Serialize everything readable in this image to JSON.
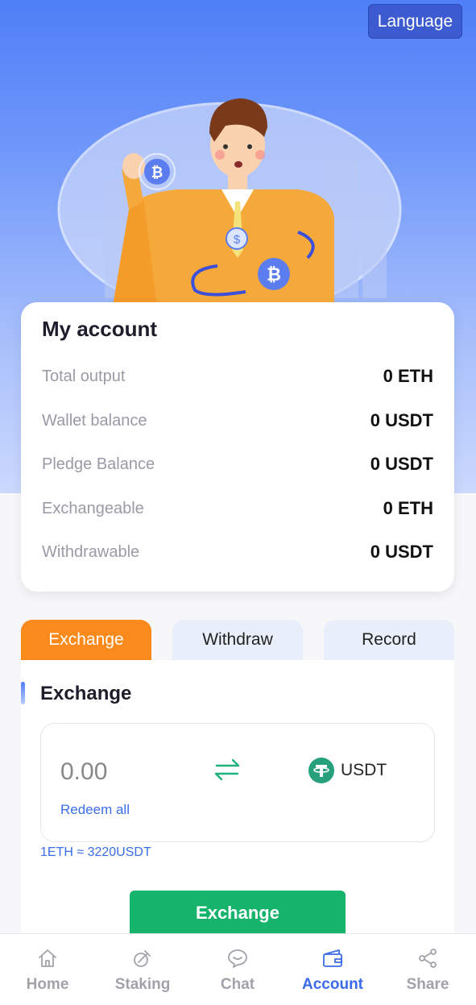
{
  "header": {
    "language_label": "Language"
  },
  "account": {
    "title": "My account",
    "rows": [
      {
        "label": "Total output",
        "value": "0 ETH"
      },
      {
        "label": "Wallet balance",
        "value": "0 USDT"
      },
      {
        "label": "Pledge Balance",
        "value": "0 USDT"
      },
      {
        "label": "Exchangeable",
        "value": "0 ETH"
      },
      {
        "label": "Withdrawable",
        "value": "0 USDT"
      }
    ]
  },
  "tabs": [
    {
      "label": "Exchange",
      "active": true
    },
    {
      "label": "Withdraw",
      "active": false
    },
    {
      "label": "Record",
      "active": false
    }
  ],
  "exchange": {
    "title": "Exchange",
    "amount_placeholder": "0.00",
    "amount_value": "",
    "redeem_all": "Redeem all",
    "to_currency": "USDT",
    "rate": "1ETH ≈ 3220USDT",
    "button_label": "Exchange"
  },
  "nav": [
    {
      "label": "Home",
      "icon": "home-icon",
      "active": false
    },
    {
      "label": "Staking",
      "icon": "staking-icon",
      "active": false
    },
    {
      "label": "Chat",
      "icon": "chat-icon",
      "active": false
    },
    {
      "label": "Account",
      "icon": "wallet-icon",
      "active": true
    },
    {
      "label": "Share",
      "icon": "share-icon",
      "active": false
    }
  ],
  "colors": {
    "primary_blue": "#4f7ff7",
    "active_tab": "#fb8a1c",
    "exchange_button": "#16b36d",
    "nav_active": "#3b6bea",
    "usdt_green": "#26a17b"
  }
}
